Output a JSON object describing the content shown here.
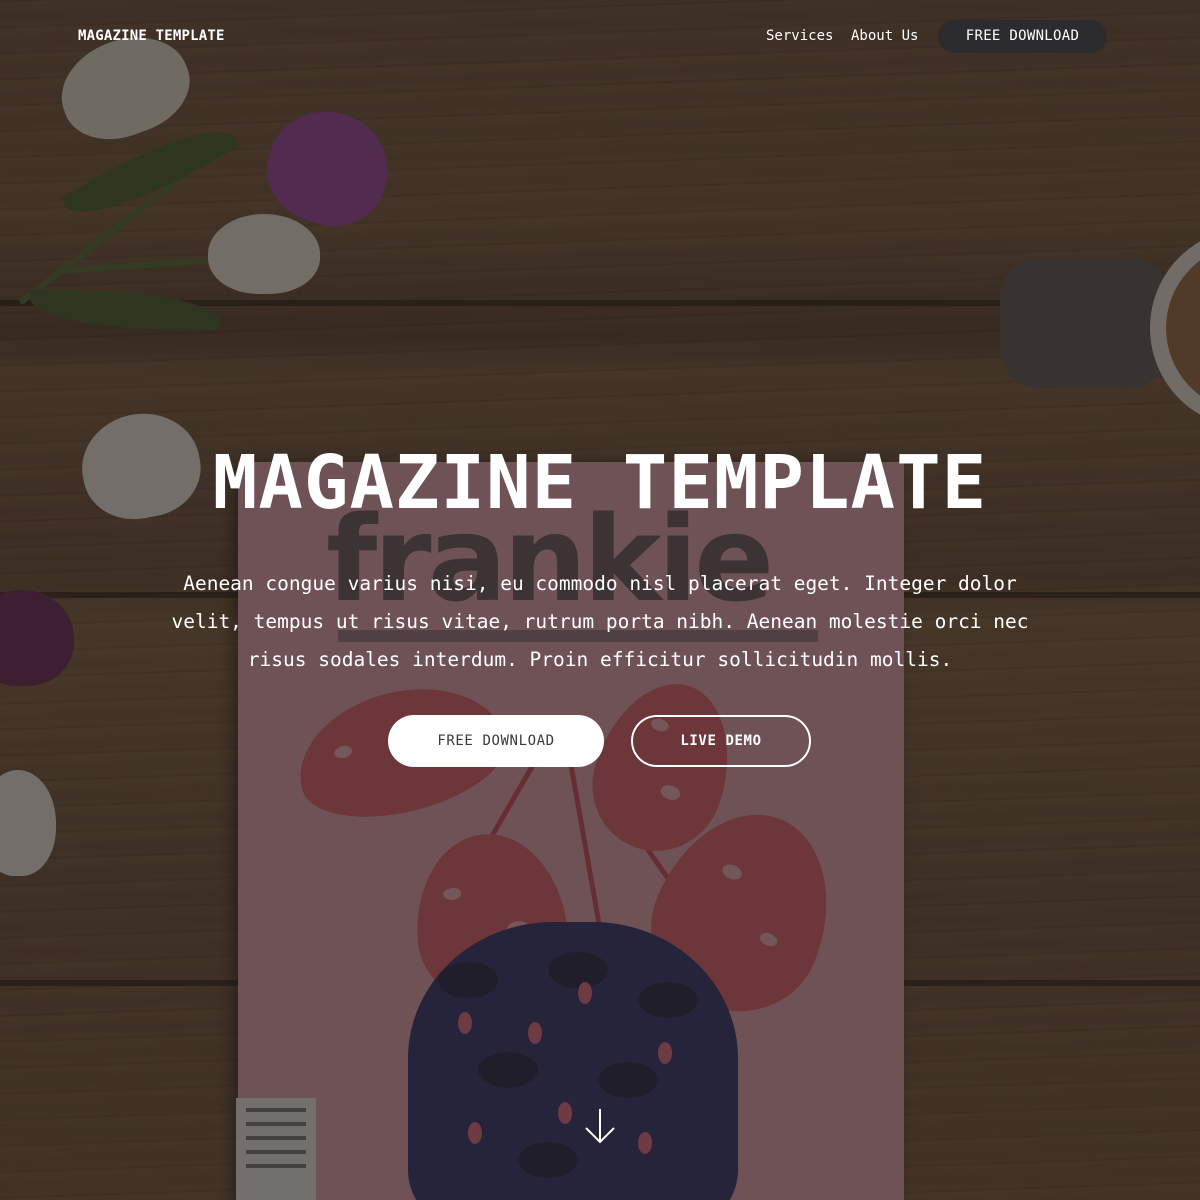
{
  "navbar": {
    "brand": "MAGAZINE TEMPLATE",
    "links": [
      {
        "label": "Services"
      },
      {
        "label": "About Us"
      }
    ],
    "cta_label": "FREE DOWNLOAD"
  },
  "hero": {
    "title": "MAGAZINE TEMPLATE",
    "description": "Aenean congue varius nisi, eu commodo nisl placerat eget. Integer dolor velit, tempus ut risus vitae, rutrum porta nibh. Aenean molestie orci nec risus sodales interdum. Proin efficitur sollicitudin mollis.",
    "primary_button": "FREE DOWNLOAD",
    "secondary_button": "LIVE DEMO"
  },
  "background": {
    "magazine_cover_text": "frankie"
  },
  "icons": {
    "scroll": "arrow-down-icon"
  },
  "colors": {
    "overlay": "#241e1b",
    "nav_button": "#2c2b2d",
    "text": "#ffffff"
  }
}
